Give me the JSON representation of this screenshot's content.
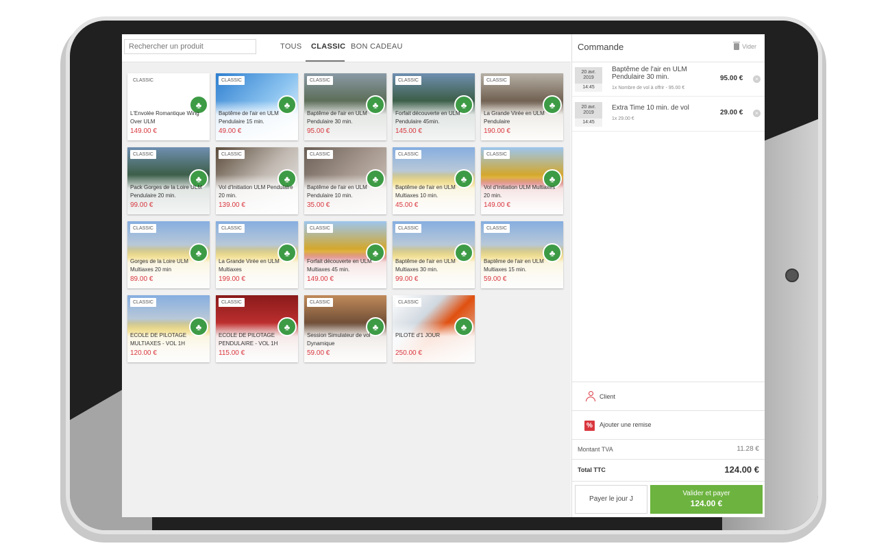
{
  "search": {
    "placeholder": "Rechercher un produit"
  },
  "tabs": [
    {
      "label": "TOUS",
      "active": false
    },
    {
      "label": "CLASSIC",
      "active": true
    },
    {
      "label": "BON CADEAU",
      "active": false
    }
  ],
  "products": [
    {
      "badge": "CLASSIC",
      "name": "L'Envolée Romantique Wing Over ULM",
      "price": "149.00 €",
      "image": "none"
    },
    {
      "badge": "CLASSIC",
      "name": "Baptême de l'air en ULM Pendulaire 15 min.",
      "price": "49.00 €",
      "image": "sky"
    },
    {
      "badge": "CLASSIC",
      "name": "Baptême de l'air en ULM Pendulaire 30 min.",
      "price": "95.00 €",
      "image": "coast"
    },
    {
      "badge": "CLASSIC",
      "name": "Forfait découverte en ULM Pendulaire 45min.",
      "price": "145.00 €",
      "image": "gorge"
    },
    {
      "badge": "CLASSIC",
      "name": "La Grande Virée en ULM Pendulaire",
      "price": "190.00 €",
      "image": "field"
    },
    {
      "badge": "CLASSIC",
      "name": "Pack Gorges de la Loire ULM Pendulaire 20 min.",
      "price": "99.00 €",
      "image": "gorge"
    },
    {
      "badge": "CLASSIC",
      "name": "Vol d'Initiation ULM Pendulaire 20 min.",
      "price": "139.00 €",
      "image": "wing"
    },
    {
      "badge": "CLASSIC",
      "name": "Baptême de l'air en ULM Pendulaire 10 min.",
      "price": "35.00 €",
      "image": "cockpit"
    },
    {
      "badge": "CLASSIC",
      "name": "Baptême de l'air en ULM Multiaxes 10 min.",
      "price": "45.00 €",
      "image": "hangar"
    },
    {
      "badge": "CLASSIC",
      "name": "Vol d'Initiation ULM Multiaxes 20 min.",
      "price": "149.00 €",
      "image": "plane"
    },
    {
      "badge": "CLASSIC",
      "name": "Gorges de la Loire ULM Multiaxes 20 min",
      "price": "89.00 €",
      "image": "hangar"
    },
    {
      "badge": "CLASSIC",
      "name": "La Grande Virée en ULM Multiaxes",
      "price": "199.00 €",
      "image": "hangar"
    },
    {
      "badge": "CLASSIC",
      "name": "Forfait découverte en ULM Multiaxes 45 min.",
      "price": "149.00 €",
      "image": "plane"
    },
    {
      "badge": "CLASSIC",
      "name": "Baptême de l'air en ULM Multiaxes 30 min.",
      "price": "99.00 €",
      "image": "hangar"
    },
    {
      "badge": "CLASSIC",
      "name": "Baptême de l'air en ULM Multiaxes 15 min.",
      "price": "59.00 €",
      "image": "hangar"
    },
    {
      "badge": "CLASSIC",
      "name": "ECOLE DE PILOTAGE MULTIAXES - VOL 1H",
      "price": "120.00 €",
      "image": "hangar"
    },
    {
      "badge": "CLASSIC",
      "name": "ECOLE DE PILOTAGE PENDULAIRE - VOL 1H",
      "price": "115.00 €",
      "image": "red"
    },
    {
      "badge": "CLASSIC",
      "name": "Session Simulateur de vol Dynamique",
      "price": "59.00 €",
      "image": "sim"
    },
    {
      "badge": "CLASSIC",
      "name": "PILOTE d'1 JOUR",
      "price": "250.00 €",
      "image": "wingover"
    }
  ],
  "order": {
    "title": "Commande",
    "clear_label": "Vider",
    "items": [
      {
        "date": "20 avr. 2019",
        "day": "20 avr.",
        "year": "2019",
        "time": "14:45",
        "name": "Baptême de l'air en ULM Pendulaire 30 min.",
        "detail": "1x Nombre de vol à offrir - 95.00 €",
        "price": "95.00 €"
      },
      {
        "date": "20 avr. 2019",
        "day": "20 avr.",
        "year": "2019",
        "time": "14:45",
        "name": "Extra Time 10 min. de vol",
        "detail": "1x 29.00 €",
        "price": "29.00 €"
      }
    ],
    "client_label": "Client",
    "discount_label": "Ajouter une remise",
    "tva_label": "Montant TVA",
    "tva_value": "11.28 €",
    "total_label": "Total TTC",
    "total_value": "124.00 €",
    "pay_later_label": "Payer le jour J",
    "pay_now_label": "Valider et payer",
    "pay_now_amount": "124.00 €"
  },
  "colors": {
    "accent_green": "#6cb33f",
    "price_red": "#d9363e",
    "logo_green": "#3d9b45"
  },
  "icons": {
    "logo": "paraglider-tree-logo",
    "clear": "trash-icon",
    "remove": "close-circle-icon",
    "client": "person-icon",
    "discount": "percent-icon"
  }
}
